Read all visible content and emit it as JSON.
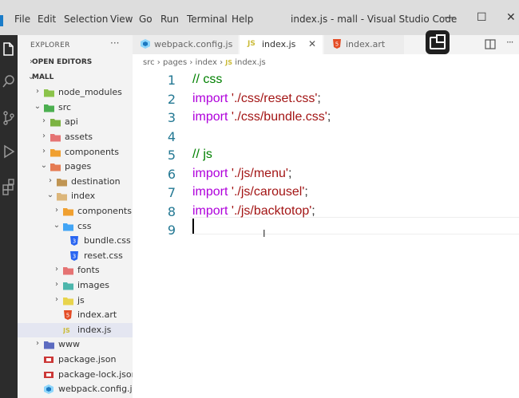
{
  "titlebar": {
    "menus": [
      "File",
      "Edit",
      "Selection",
      "View",
      "Go",
      "Run",
      "Terminal",
      "Help"
    ],
    "title": "index.js - mall - Visual Studio Code",
    "min": "—",
    "max": "☐",
    "close": "✕"
  },
  "sidebar": {
    "header": "EXPLORER",
    "more": "···",
    "rows": [
      {
        "label": "OPEN EDITORS",
        "chev": "›",
        "type": "section"
      },
      {
        "label": "MALL",
        "chev": "⌄",
        "type": "section"
      },
      {
        "label": "node_modules",
        "chev": "›",
        "icon": "node-folder-icon"
      },
      {
        "label": "src",
        "chev": "⌄",
        "icon": "src-folder-icon"
      },
      {
        "label": "api",
        "chev": "›",
        "icon": "api-folder-icon"
      },
      {
        "label": "assets",
        "chev": "›",
        "icon": "assets-folder-icon"
      },
      {
        "label": "components",
        "chev": "›",
        "icon": "components-folder-icon"
      },
      {
        "label": "pages",
        "chev": "⌄",
        "icon": "pages-folder-icon"
      },
      {
        "label": "destination",
        "chev": "›",
        "icon": "folder-icon"
      },
      {
        "label": "index",
        "chev": "⌄",
        "icon": "folder-open-icon"
      },
      {
        "label": "components",
        "chev": "›",
        "icon": "components-folder-icon"
      },
      {
        "label": "css",
        "chev": "⌄",
        "icon": "css-folder-icon"
      },
      {
        "label": "bundle.css",
        "chev": "",
        "icon": "css-file-icon"
      },
      {
        "label": "reset.css",
        "chev": "",
        "icon": "css-file-icon"
      },
      {
        "label": "fonts",
        "chev": "›",
        "icon": "fonts-folder-icon"
      },
      {
        "label": "images",
        "chev": "›",
        "icon": "images-folder-icon"
      },
      {
        "label": "js",
        "chev": "›",
        "icon": "js-folder-icon"
      },
      {
        "label": "index.art",
        "chev": "",
        "icon": "html-file-icon"
      },
      {
        "label": "index.js",
        "chev": "",
        "icon": "js-file-icon",
        "selected": true
      },
      {
        "label": "www",
        "chev": "›",
        "icon": "www-folder-icon"
      },
      {
        "label": "package.json",
        "chev": "",
        "icon": "npm-file-icon"
      },
      {
        "label": "package-lock.json",
        "chev": "",
        "icon": "npm-file-icon"
      },
      {
        "label": "webpack.config.js",
        "chev": "",
        "icon": "webpack-file-icon"
      }
    ]
  },
  "tabs": [
    {
      "label": "webpack.config.js",
      "icon": "webpack-file-icon"
    },
    {
      "label": "index.js",
      "icon": "js-file-icon",
      "close": "✕",
      "active": true
    },
    {
      "label": "index.art",
      "icon": "html-file-icon"
    }
  ],
  "breadcrumb": [
    "src",
    "pages",
    "index",
    "index.js"
  ],
  "editor": {
    "lines": [
      {
        "n": "1",
        "parts": [
          {
            "c": "cmt",
            "t": "// css"
          }
        ]
      },
      {
        "n": "2",
        "parts": [
          {
            "c": "kw",
            "t": "import "
          },
          {
            "c": "str",
            "t": "'./css/reset.css'"
          },
          {
            "c": "pn",
            "t": ";"
          }
        ]
      },
      {
        "n": "3",
        "parts": [
          {
            "c": "kw",
            "t": "import "
          },
          {
            "c": "str",
            "t": "'./css/bundle.css'"
          },
          {
            "c": "pn",
            "t": ";"
          }
        ]
      },
      {
        "n": "4",
        "parts": []
      },
      {
        "n": "5",
        "parts": [
          {
            "c": "cmt",
            "t": "// js"
          }
        ]
      },
      {
        "n": "6",
        "parts": [
          {
            "c": "kw",
            "t": "import "
          },
          {
            "c": "str",
            "t": "'./js/menu'"
          },
          {
            "c": "pn",
            "t": ";"
          }
        ]
      },
      {
        "n": "7",
        "parts": [
          {
            "c": "kw",
            "t": "import "
          },
          {
            "c": "str",
            "t": "'./js/carousel'"
          },
          {
            "c": "pn",
            "t": ";"
          }
        ]
      },
      {
        "n": "8",
        "parts": [
          {
            "c": "kw",
            "t": "import "
          },
          {
            "c": "str",
            "t": "'./js/backtotop'"
          },
          {
            "c": "pn",
            "t": ";"
          }
        ]
      },
      {
        "n": "9",
        "parts": []
      }
    ]
  },
  "colors": {
    "comment": "#008000",
    "keyword": "#af00db",
    "string": "#a31515",
    "lineNumber": "#237893"
  }
}
